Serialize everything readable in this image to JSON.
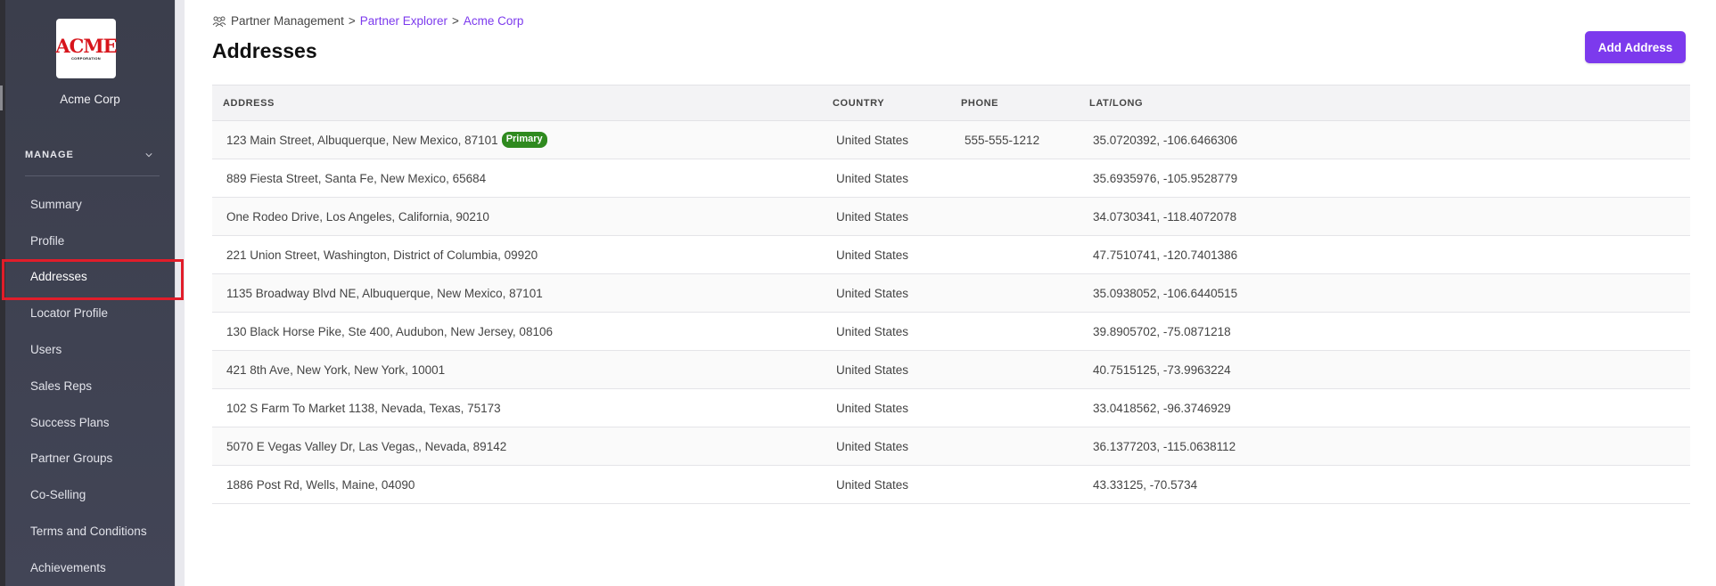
{
  "sidebar": {
    "logo": {
      "main": "ACME",
      "sub": "CORPORATION"
    },
    "org_name": "Acme Corp",
    "section_label": "MANAGE",
    "items": [
      {
        "label": "Summary"
      },
      {
        "label": "Profile"
      },
      {
        "label": "Addresses",
        "active": true
      },
      {
        "label": "Locator Profile"
      },
      {
        "label": "Users"
      },
      {
        "label": "Sales Reps"
      },
      {
        "label": "Success Plans"
      },
      {
        "label": "Partner Groups"
      },
      {
        "label": "Co-Selling"
      },
      {
        "label": "Terms and Conditions"
      },
      {
        "label": "Achievements"
      }
    ]
  },
  "breadcrumb": {
    "root": "Partner Management",
    "sep": ">",
    "middle": "Partner Explorer",
    "current": "Acme Corp"
  },
  "page_title": "Addresses",
  "add_button_label": "Add Address",
  "table": {
    "headers": {
      "address": "ADDRESS",
      "country": "COUNTRY",
      "phone": "PHONE",
      "latlong": "LAT/LONG"
    },
    "rows": [
      {
        "address": "123 Main Street, Albuquerque, New Mexico, 87101",
        "badge": "Primary",
        "country": "United States",
        "phone": "555-555-1212",
        "latlong": "35.0720392, -106.6466306"
      },
      {
        "address": "889 Fiesta Street, Santa Fe, New Mexico, 65684",
        "badge": "",
        "country": "United States",
        "phone": "",
        "latlong": "35.6935976, -105.9528779"
      },
      {
        "address": "One Rodeo Drive, Los Angeles, California, 90210",
        "badge": "",
        "country": "United States",
        "phone": "",
        "latlong": "34.0730341, -118.4072078"
      },
      {
        "address": "221 Union Street, Washington, District of Columbia, 09920",
        "badge": "",
        "country": "United States",
        "phone": "",
        "latlong": "47.7510741, -120.7401386"
      },
      {
        "address": "1135 Broadway Blvd NE, Albuquerque, New Mexico, 87101",
        "badge": "",
        "country": "United States",
        "phone": "",
        "latlong": "35.0938052, -106.6440515"
      },
      {
        "address": "130 Black Horse Pike, Ste 400, Audubon, New Jersey, 08106",
        "badge": "",
        "country": "United States",
        "phone": "",
        "latlong": "39.8905702, -75.0871218"
      },
      {
        "address": "421 8th Ave, New York, New York, 10001",
        "badge": "",
        "country": "United States",
        "phone": "",
        "latlong": "40.7515125, -73.9963224"
      },
      {
        "address": "102 S Farm To Market 1138, Nevada, Texas, 75173",
        "badge": "",
        "country": "United States",
        "phone": "",
        "latlong": "33.0418562, -96.3746929"
      },
      {
        "address": "5070 E Vegas Valley Dr, Las Vegas,, Nevada, 89142",
        "badge": "",
        "country": "United States",
        "phone": "",
        "latlong": "36.1377203, -115.0638112"
      },
      {
        "address": "1886 Post Rd, Wells, Maine, 04090",
        "badge": "",
        "country": "United States",
        "phone": "",
        "latlong": "43.33125, -70.5734"
      }
    ]
  },
  "colors": {
    "accent": "#7c3aed",
    "primary_badge": "#2f8a1f",
    "active_outline": "#e11d2a",
    "sidebar_bg": "#3b3e4c"
  },
  "icons": {
    "breadcrumb": "partners-icon",
    "manage_toggle": "chevron-down-icon"
  }
}
